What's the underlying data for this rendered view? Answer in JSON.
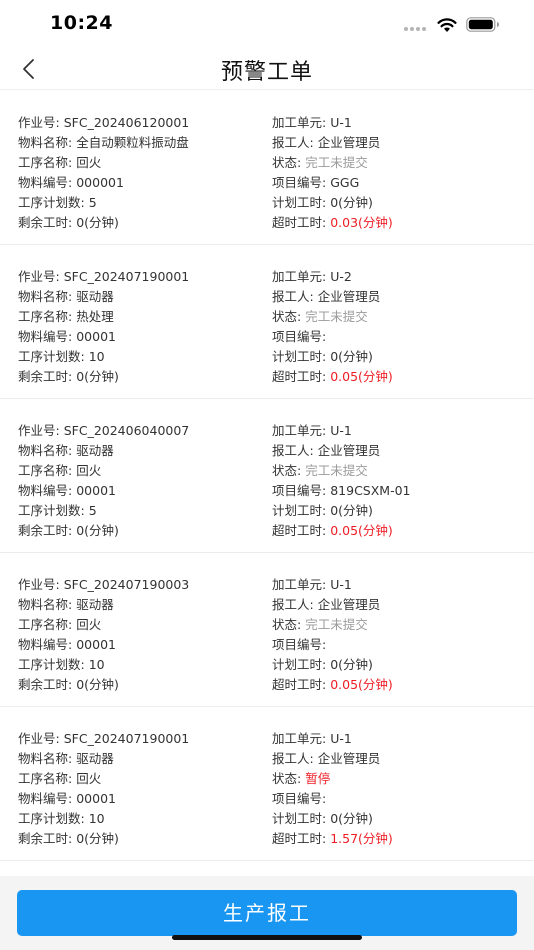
{
  "status_bar": {
    "time": "10:24"
  },
  "nav": {
    "title": "预警工单"
  },
  "labels": {
    "job_no": "作业号:",
    "material_name": "物料名称:",
    "process_name": "工序名称:",
    "material_code": "物料编号:",
    "planned_qty": "工序计划数:",
    "remaining_time": "剩余工时:",
    "work_unit": "加工单元:",
    "reporter": "报工人:",
    "status": "状态:",
    "project_code": "项目编号:",
    "planned_time": "计划工时:",
    "overtime": "超时工时:"
  },
  "orders": [
    {
      "job_no": "SFC_202406120001",
      "material_name": "全自动颗粒料振动盘",
      "process_name": "回火",
      "material_code": "000001",
      "planned_qty": "5",
      "remaining_time": "0(分钟)",
      "work_unit": "U-1",
      "reporter": "企业管理员",
      "status": "完工未提交",
      "project_code": "GGG",
      "planned_time": "0(分钟)",
      "overtime": "0.03(分钟)"
    },
    {
      "job_no": "SFC_202407190001",
      "material_name": "驱动器",
      "process_name": "热处理",
      "material_code": "00001",
      "planned_qty": "10",
      "remaining_time": "0(分钟)",
      "work_unit": "U-2",
      "reporter": "企业管理员",
      "status": "完工未提交",
      "project_code": "",
      "planned_time": "0(分钟)",
      "overtime": "0.05(分钟)"
    },
    {
      "job_no": "SFC_202406040007",
      "material_name": "驱动器",
      "process_name": "回火",
      "material_code": "00001",
      "planned_qty": "5",
      "remaining_time": "0(分钟)",
      "work_unit": "U-1",
      "reporter": "企业管理员",
      "status": "完工未提交",
      "project_code": "819CSXM-01",
      "planned_time": "0(分钟)",
      "overtime": "0.05(分钟)"
    },
    {
      "job_no": "SFC_202407190003",
      "material_name": "驱动器",
      "process_name": "回火",
      "material_code": "00001",
      "planned_qty": "10",
      "remaining_time": "0(分钟)",
      "work_unit": "U-1",
      "reporter": "企业管理员",
      "status": "完工未提交",
      "project_code": "",
      "planned_time": "0(分钟)",
      "overtime": "0.05(分钟)"
    },
    {
      "job_no": "SFC_202407190001",
      "material_name": "驱动器",
      "process_name": "回火",
      "material_code": "00001",
      "planned_qty": "10",
      "remaining_time": "0(分钟)",
      "work_unit": "U-1",
      "reporter": "企业管理员",
      "status": "暂停",
      "project_code": "",
      "planned_time": "0(分钟)",
      "overtime": "1.57(分钟)"
    }
  ],
  "status_colors": {
    "完工未提交": "#9b9b9b",
    "暂停": "#ee1d24"
  },
  "overtime_color": "#ee1d24",
  "accent_color": "#1995f2",
  "footer": {
    "submit_label": "生产报工"
  }
}
